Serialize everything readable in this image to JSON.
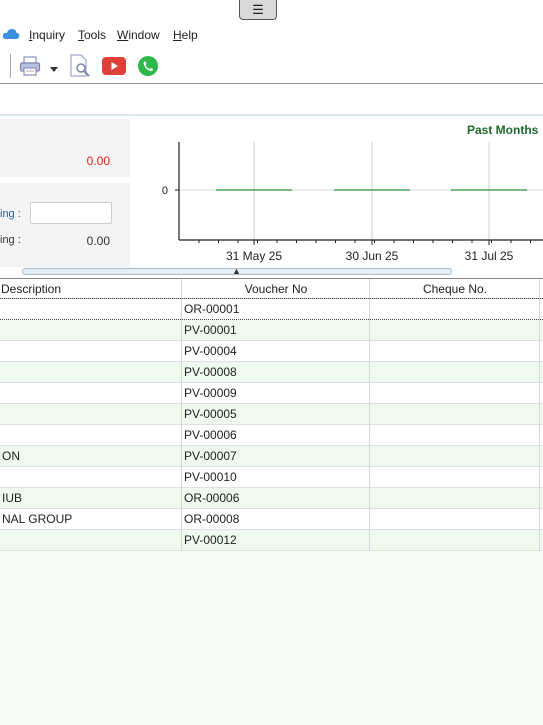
{
  "menu": {
    "items": [
      {
        "label": "Inquiry",
        "hotkey": "I",
        "rest": "nquiry"
      },
      {
        "label": "Tools",
        "hotkey": "T",
        "rest": "ools"
      },
      {
        "label": "Window",
        "hotkey": "W",
        "rest": "indow"
      },
      {
        "label": "Help",
        "hotkey": "H",
        "rest": "elp"
      }
    ]
  },
  "toolbar": {
    "icons": [
      "print-icon",
      "dropdown-arrow-icon",
      "print-preview-icon",
      "youtube-icon",
      "whatsapp-icon"
    ]
  },
  "summary": {
    "amount_red": "0.00",
    "pending_label": "ing :",
    "pending_value": "",
    "closing_label": "ing :",
    "closing_value": "0.00"
  },
  "chart_data": {
    "type": "line",
    "title": "Past Months",
    "categories": [
      "31 May 25",
      "30 Jun 25",
      "31 Jul 25"
    ],
    "series": [
      {
        "values": [
          0,
          0,
          0
        ]
      }
    ],
    "yticks": [
      0
    ],
    "grid": true,
    "colors": {
      "series": "#2e8b3d",
      "title": "#1e6b2c"
    }
  },
  "grid": {
    "columns": [
      "Description",
      "Voucher No",
      "Cheque No."
    ],
    "rows": [
      {
        "description": "",
        "voucher": "OR-00001",
        "cheque": ""
      },
      {
        "description": "",
        "voucher": "PV-00001",
        "cheque": ""
      },
      {
        "description": "",
        "voucher": "PV-00004",
        "cheque": ""
      },
      {
        "description": "",
        "voucher": "PV-00008",
        "cheque": ""
      },
      {
        "description": "",
        "voucher": "PV-00009",
        "cheque": ""
      },
      {
        "description": "",
        "voucher": "PV-00005",
        "cheque": ""
      },
      {
        "description": "",
        "voucher": "PV-00006",
        "cheque": ""
      },
      {
        "description": "ON",
        "voucher": "PV-00007",
        "cheque": ""
      },
      {
        "description": "",
        "voucher": "PV-00010",
        "cheque": ""
      },
      {
        "description": "IUB",
        "voucher": "OR-00006",
        "cheque": ""
      },
      {
        "description": "NAL GROUP",
        "voucher": "OR-00008",
        "cheque": ""
      },
      {
        "description": "",
        "voucher": "PV-00012",
        "cheque": ""
      }
    ]
  },
  "colors": {
    "row_alt": "#eefaee",
    "row_plain": "#ffffff",
    "bottom_fill": "#f4fcf4"
  }
}
